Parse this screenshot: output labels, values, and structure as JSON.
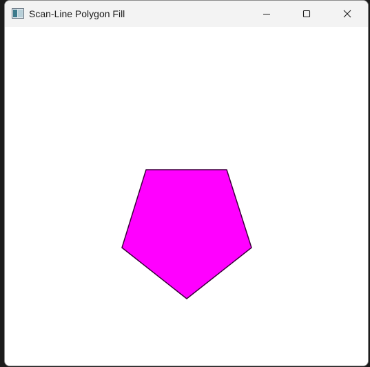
{
  "window": {
    "title": "Scan-Line Polygon Fill",
    "controls": [
      "minimize-icon",
      "maximize-icon",
      "close-icon"
    ]
  },
  "canvas": {
    "background": "#ffffff",
    "shape": "pentagon",
    "fill_color": "#ff00ff",
    "edge_color": "#3a003a"
  }
}
